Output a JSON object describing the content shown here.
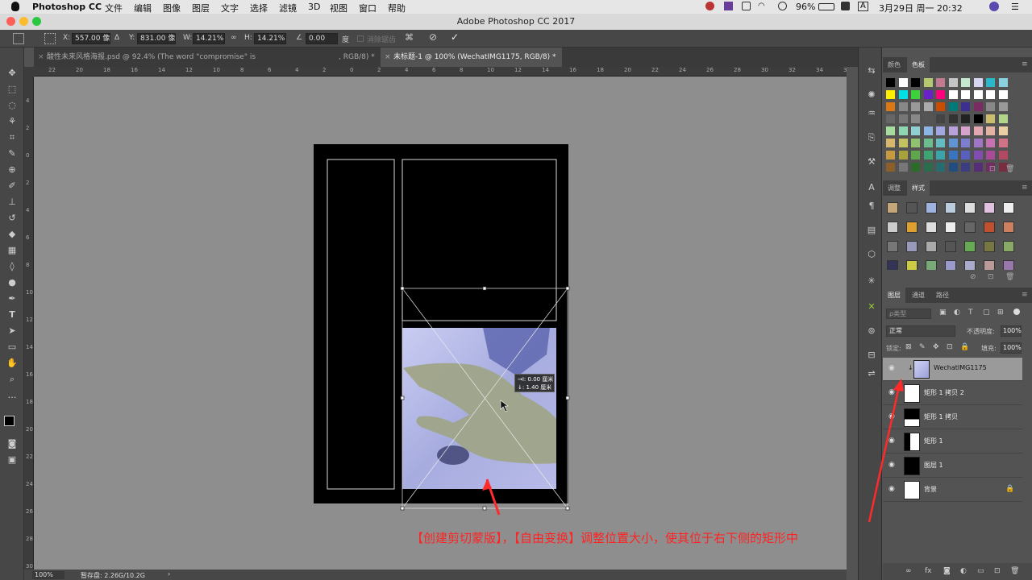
{
  "menubar": {
    "app": "Photoshop CC",
    "items": [
      "文件",
      "编辑",
      "图像",
      "图层",
      "文字",
      "选择",
      "滤镜",
      "3D",
      "视图",
      "窗口",
      "帮助"
    ],
    "battery": "96%",
    "input": "A",
    "datetime": "3月29日 周一 20:32"
  },
  "window": {
    "title": "Adobe Photoshop CC 2017"
  },
  "options": {
    "x_label": "X:",
    "x": "557.00 像素",
    "y_label": "Y:",
    "y": "831.00 像素",
    "w_label": "W:",
    "w": "14.21%",
    "h_label": "H:",
    "h": "14.21%",
    "angle": "0.00",
    "angle_unit": "度",
    "antialias": "消除锯齿"
  },
  "tabs": [
    {
      "label": "酸性未来风格海报.psd @ 92.4% (The word \"compromise\" is",
      "suffix": ", RGB/8) *"
    },
    {
      "label": "未标题-1 @ 100% (WechatIMG1175, RGB/8) *"
    }
  ],
  "ruler": {
    "h": [
      "22",
      "20",
      "18",
      "16",
      "14",
      "12",
      "10",
      "8",
      "6",
      "4",
      "2",
      "0",
      "2",
      "4",
      "6",
      "8",
      "10",
      "12",
      "14",
      "16",
      "18",
      "20",
      "22",
      "24",
      "26",
      "28",
      "30",
      "32",
      "34",
      "36",
      "38"
    ],
    "v": [
      "4",
      "2",
      "0",
      "2",
      "4",
      "6",
      "8",
      "10",
      "12",
      "14",
      "16",
      "18",
      "20",
      "22",
      "24",
      "26",
      "28",
      "30"
    ]
  },
  "tooltip": {
    "line1": "→I: 0.00 厘米",
    "line2": "↓: 1.40 厘米"
  },
  "status": {
    "zoom": "100%",
    "disk": "暂存盘: 2.26G/10.2G"
  },
  "panels": {
    "color_tabs": [
      "颜色",
      "色板"
    ],
    "style_tabs": [
      "调整",
      "样式"
    ],
    "layer_tabs": [
      "图层",
      "通道",
      "路径"
    ],
    "filter_label": "ρ类型",
    "blend_mode": "正常",
    "opacity_label": "不透明度:",
    "opacity": "100%",
    "lock_label": "锁定:",
    "fill_label": "填充:",
    "fill": "100%"
  },
  "layers": [
    {
      "name": "WechatIMG1175",
      "selected": true
    },
    {
      "name": "矩形 1 拷贝 2"
    },
    {
      "name": "矩形 1 拷贝"
    },
    {
      "name": "矩形 1"
    },
    {
      "name": "图层 1"
    },
    {
      "name": "背景",
      "locked": true
    }
  ],
  "annotation": "【创建剪切蒙版】，【自由变换】调整位置大小，使其位于右下侧的矩形中",
  "colors": {
    "arrow": "#ff2a2a",
    "accent": "#1473e6"
  }
}
